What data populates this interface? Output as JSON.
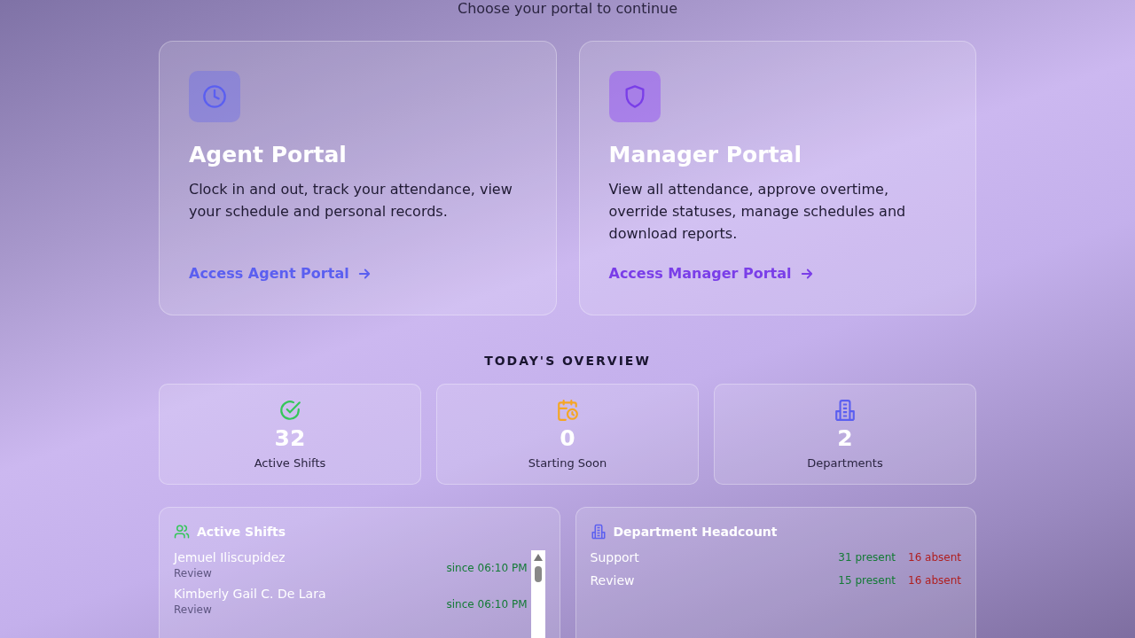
{
  "subtitle": "Choose your portal to continue",
  "portals": [
    {
      "kind": "agent",
      "title": "Agent Portal",
      "description": "Clock in and out, track your attendance, view your schedule and personal records.",
      "link": "Access Agent Portal"
    },
    {
      "kind": "manager",
      "title": "Manager Portal",
      "description": "View all attendance, approve overtime, override statuses, manage schedules and download reports.",
      "link": "Access Manager Portal"
    }
  ],
  "overview": {
    "heading": "TODAY'S OVERVIEW",
    "stats": [
      {
        "kind": "active",
        "value": "32",
        "label": "Active Shifts"
      },
      {
        "kind": "soon",
        "value": "0",
        "label": "Starting Soon"
      },
      {
        "kind": "departments",
        "value": "2",
        "label": "Departments"
      }
    ]
  },
  "active_shifts": {
    "title": "Active Shifts",
    "rows": [
      {
        "name": "Jemuel Iliscupidez",
        "department": "Review",
        "since": "since 06:10 PM"
      },
      {
        "name": "Kimberly Gail C. De Lara",
        "department": "Review",
        "since": "since 06:10 PM"
      }
    ]
  },
  "department_headcount": {
    "title": "Department Headcount",
    "rows": [
      {
        "department": "Support",
        "present": "31 present",
        "absent": "16 absent"
      },
      {
        "department": "Review",
        "present": "15 present",
        "absent": "16 absent"
      }
    ]
  }
}
